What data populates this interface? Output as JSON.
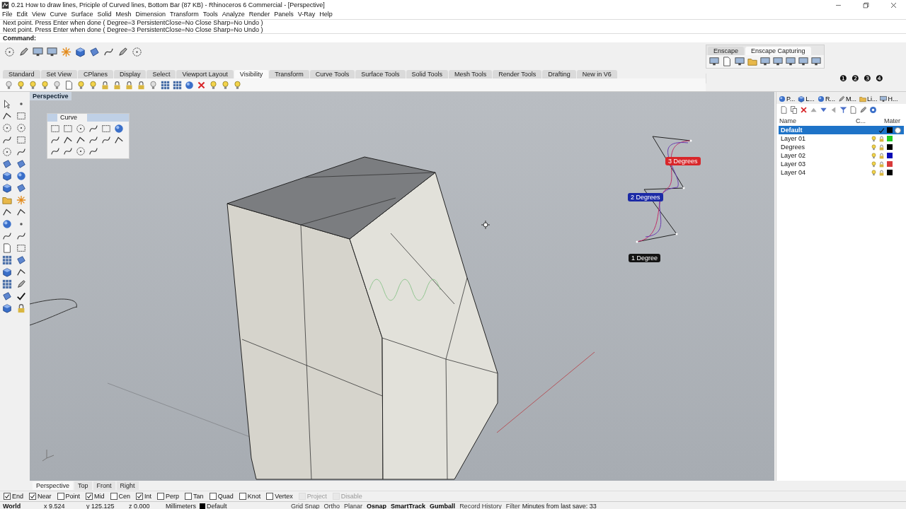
{
  "window": {
    "title": "0.21 How to draw lines, Priciple of Curved lines, Bottom Bar (87 KB) - Rhinoceros 6 Commercial - [Perspective]"
  },
  "menu": [
    "File",
    "Edit",
    "View",
    "Curve",
    "Surface",
    "Solid",
    "Mesh",
    "Dimension",
    "Transform",
    "Tools",
    "Analyze",
    "Render",
    "Panels",
    "V-Ray",
    "Help"
  ],
  "command_history": [
    "Next point. Press Enter when done ( Degree=3  PersistentClose=No  Close  Sharp=No  Undo )",
    "Next point. Press Enter when done ( Degree=3  PersistentClose=No  Close  Sharp=No  Undo )"
  ],
  "command_prompt": "Command:",
  "enscape_tabs": [
    {
      "label": "Enscape",
      "selected": false
    },
    {
      "label": "Enscape Capturing",
      "selected": true
    }
  ],
  "toolbar_tabs": [
    {
      "label": "Standard",
      "selected": false
    },
    {
      "label": "Set View",
      "selected": false
    },
    {
      "label": "CPlanes",
      "selected": false
    },
    {
      "label": "Display",
      "selected": false
    },
    {
      "label": "Select",
      "selected": false
    },
    {
      "label": "Viewport Layout",
      "selected": false
    },
    {
      "label": "Visibility",
      "selected": true
    },
    {
      "label": "Transform",
      "selected": false
    },
    {
      "label": "Curve Tools",
      "selected": false
    },
    {
      "label": "Surface Tools",
      "selected": false
    },
    {
      "label": "Solid Tools",
      "selected": false
    },
    {
      "label": "Mesh Tools",
      "selected": false
    },
    {
      "label": "Render Tools",
      "selected": false
    },
    {
      "label": "Drafting",
      "selected": false
    },
    {
      "label": "New in V6",
      "selected": false
    }
  ],
  "viewport_numbers": [
    "❶",
    "❷",
    "❸",
    "❹"
  ],
  "viewport": {
    "title": "Perspective",
    "curve_palette": {
      "title": "Curve"
    },
    "labels": [
      {
        "text": "3 Degrees",
        "color": "#d8262a"
      },
      {
        "text": "2 Degrees",
        "color": "#1c2aa6"
      },
      {
        "text": "1 Degree",
        "color": "#141414"
      }
    ]
  },
  "layers_panel": {
    "tabs": [
      "P...",
      "L...",
      "R...",
      "M...",
      "Li...",
      "H..."
    ],
    "columns": [
      "Name",
      "C...",
      "Mater"
    ],
    "layers": [
      {
        "name": "Default",
        "selected": true,
        "current": true,
        "has_material": true,
        "color": "#000000"
      },
      {
        "name": "Layer 01",
        "selected": false,
        "current": false,
        "has_material": false,
        "color": "#22cc22"
      },
      {
        "name": "Degrees",
        "selected": false,
        "current": false,
        "has_material": false,
        "color": "#000000"
      },
      {
        "name": "Layer 02",
        "selected": false,
        "current": false,
        "has_material": false,
        "color": "#0a0ab4"
      },
      {
        "name": "Layer 03",
        "selected": false,
        "current": false,
        "has_material": false,
        "color": "#d83a3a"
      },
      {
        "name": "Layer 04",
        "selected": false,
        "current": false,
        "has_material": false,
        "color": "#000000"
      }
    ]
  },
  "viewport_tabs": [
    {
      "label": "Perspective",
      "selected": true
    },
    {
      "label": "Top",
      "selected": false
    },
    {
      "label": "Front",
      "selected": false
    },
    {
      "label": "Right",
      "selected": false
    }
  ],
  "osnaps": [
    {
      "label": "End",
      "checked": true,
      "disabled": false
    },
    {
      "label": "Near",
      "checked": true,
      "disabled": false
    },
    {
      "label": "Point",
      "checked": false,
      "disabled": false
    },
    {
      "label": "Mid",
      "checked": true,
      "disabled": false
    },
    {
      "label": "Cen",
      "checked": false,
      "disabled": false
    },
    {
      "label": "Int",
      "checked": true,
      "disabled": false
    },
    {
      "label": "Perp",
      "checked": false,
      "disabled": false
    },
    {
      "label": "Tan",
      "checked": false,
      "disabled": false
    },
    {
      "label": "Quad",
      "checked": false,
      "disabled": false
    },
    {
      "label": "Knot",
      "checked": false,
      "disabled": false
    },
    {
      "label": "Vertex",
      "checked": false,
      "disabled": false
    },
    {
      "label": "Project",
      "checked": false,
      "disabled": true
    },
    {
      "label": "Disable",
      "checked": false,
      "disabled": true
    }
  ],
  "status_bar": {
    "cplane": "World",
    "x": "x 9.524",
    "y": "y 125.125",
    "z": "z 0.000",
    "units": "Millimeters",
    "layer": "Default",
    "toggles": [
      {
        "label": "Grid Snap",
        "on": false
      },
      {
        "label": "Ortho",
        "on": false
      },
      {
        "label": "Planar",
        "on": false
      },
      {
        "label": "Osnap",
        "on": true
      },
      {
        "label": "SmartTrack",
        "on": true
      },
      {
        "label": "Gumball",
        "on": true
      },
      {
        "label": "Record History",
        "on": false
      },
      {
        "label": "Filter",
        "on": false
      }
    ],
    "save_info": "Minutes from last save: 33"
  }
}
